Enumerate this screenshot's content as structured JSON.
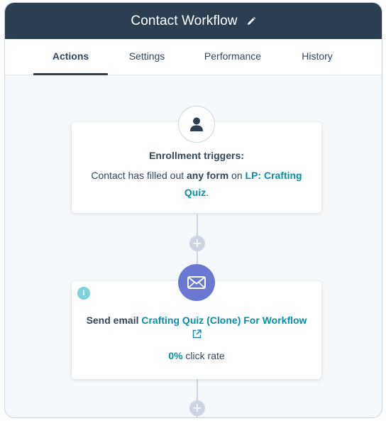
{
  "header": {
    "title": "Contact Workflow",
    "edit_icon": "pencil-icon"
  },
  "tabs": [
    {
      "label": "Actions",
      "active": true
    },
    {
      "label": "Settings",
      "active": false
    },
    {
      "label": "Performance",
      "active": false
    },
    {
      "label": "History",
      "active": false
    }
  ],
  "trigger_card": {
    "icon": "person-icon",
    "title": "Enrollment triggers:",
    "prefix": "Contact has filled out ",
    "bold": "any form",
    "middle": " on ",
    "link": "LP: Crafting Quiz",
    "suffix": "."
  },
  "plus_label": "+",
  "email_card": {
    "icon": "envelope-icon",
    "badge": "i",
    "action": "Send email ",
    "link": "Crafting Quiz (Clone) For Workflow",
    "external_icon": "external-link-icon",
    "rate_value": "0%",
    "rate_label": " click rate"
  },
  "colors": {
    "header_bg": "#2d3e50",
    "link": "#0091ae",
    "email_icon_bg": "#6a78d1",
    "connector": "#cbd6e2",
    "info_badge": "#7fd1de"
  }
}
